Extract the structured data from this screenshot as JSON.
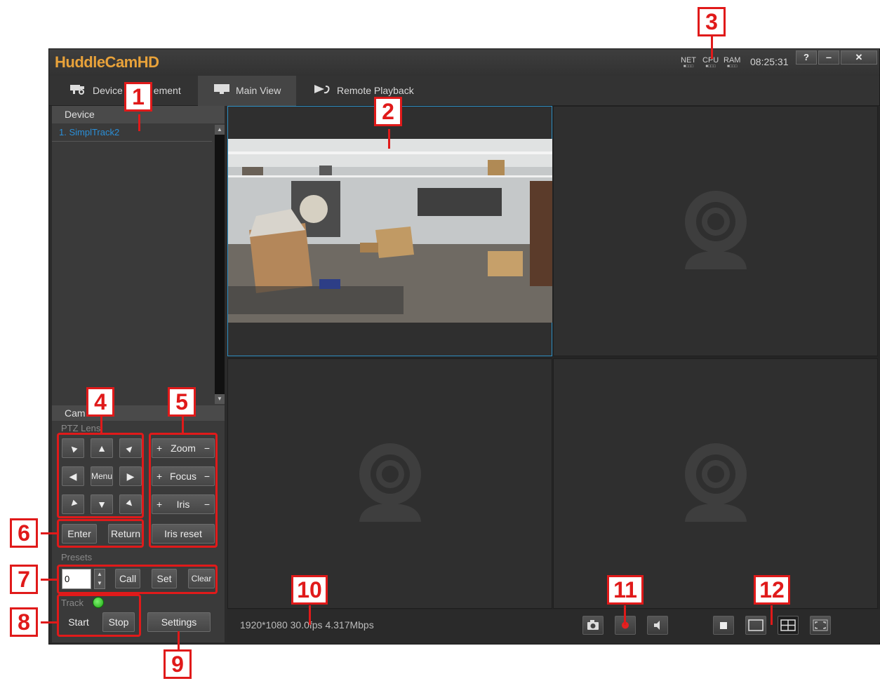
{
  "app": {
    "logo": "HuddleCamHD",
    "meters": [
      "NET",
      "CPU",
      "RAM"
    ],
    "meter_bars": "■□□□",
    "clock": "08:25:31",
    "window_buttons": [
      "?",
      "‒",
      "✕"
    ]
  },
  "tabs": [
    {
      "label": "Device Management",
      "visible_label": "Device",
      "visible_suffix": "ement",
      "icon": "camera-manage-icon"
    },
    {
      "label": "Main View",
      "icon": "monitor-icon"
    },
    {
      "label": "Remote Playback",
      "icon": "playback-icon"
    }
  ],
  "device_panel": {
    "header": "Device",
    "items": [
      {
        "label": "1. SimplTrack2"
      }
    ]
  },
  "camera_panel": {
    "header": "Cam",
    "ptz_label": "PTZ Lens",
    "ptz_arrows": [
      "up-left",
      "up",
      "up-right",
      "left",
      "Menu",
      "right",
      "down-left",
      "down",
      "down-right"
    ],
    "menu_label": "Menu",
    "zoom": {
      "plus": "+",
      "label": "Zoom",
      "minus": "−"
    },
    "focus": {
      "plus": "+",
      "label": "Focus",
      "minus": "−"
    },
    "iris": {
      "plus": "+",
      "label": "Iris",
      "minus": "−"
    },
    "iris_reset": "Iris reset",
    "enter": "Enter",
    "return": "Return",
    "presets_label": "Presets",
    "preset_value": "0",
    "call": "Call",
    "set": "Set",
    "clear": "Clear",
    "track_label": "Track",
    "start": "Start",
    "stop": "Stop",
    "settings": "Settings"
  },
  "status": {
    "stream_info": "1920*1080 30.0fps 4.317Mbps",
    "icons": [
      "snapshot-icon",
      "record-icon",
      "audio-icon",
      "single-view-icon",
      "single-frame-icon",
      "quad-view-icon",
      "fullscreen-icon"
    ]
  },
  "callouts": [
    "1",
    "2",
    "3",
    "4",
    "5",
    "6",
    "7",
    "8",
    "9",
    "10",
    "11",
    "12"
  ],
  "colors": {
    "accent": "#e8a23a",
    "callout_red": "#e01a1a",
    "selection_blue": "#2d8fc4",
    "device_link": "#2a8fd8",
    "track_led": "#3fd12c"
  }
}
